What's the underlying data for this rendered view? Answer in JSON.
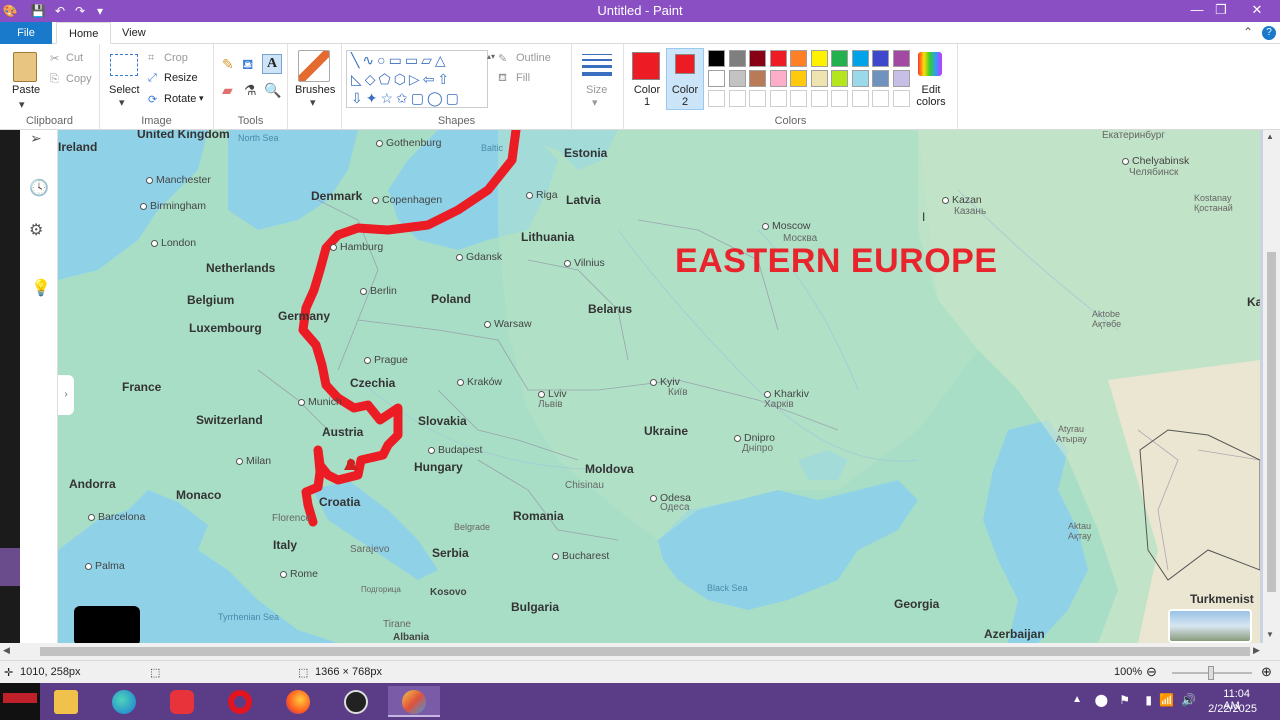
{
  "window": {
    "title": "Untitled - Paint",
    "minimize": "—",
    "maximize": "❐",
    "close": "✕"
  },
  "tabs": {
    "file": "File",
    "home": "Home",
    "view": "View"
  },
  "ribbon": {
    "clipboard": {
      "label": "Clipboard",
      "paste": "Paste",
      "cut": "Cut",
      "copy": "Copy"
    },
    "image": {
      "label": "Image",
      "select": "Select",
      "crop": "Crop",
      "resize": "Resize",
      "rotate": "Rotate"
    },
    "tools": {
      "label": "Tools"
    },
    "brushes": {
      "label": "Brushes"
    },
    "shapes": {
      "label": "Shapes",
      "outline": "Outline",
      "fill": "Fill"
    },
    "size": {
      "label": "Size"
    },
    "colors": {
      "label": "Colors",
      "color1": "Color 1",
      "color2": "Color 2",
      "edit": "Edit colors",
      "color1_value": "#ed1c24",
      "color2_value": "#ed1c24",
      "row1": [
        "#000000",
        "#7f7f7f",
        "#880015",
        "#ed1c24",
        "#ff7f27",
        "#fff200",
        "#22b14c",
        "#00a2e8",
        "#3f48cc",
        "#a349a4"
      ],
      "row2": [
        "#ffffff",
        "#c3c3c3",
        "#b97a57",
        "#ffaec9",
        "#ffc90e",
        "#efe4b0",
        "#b5e61d",
        "#99d9ea",
        "#7092be",
        "#c8bfe7"
      ]
    }
  },
  "map": {
    "headline": "EASTERN EUROPE",
    "countries": [
      "Ireland",
      "United Kingdom",
      "Denmark",
      "Estonia",
      "Latvia",
      "Lithuania",
      "Netherlands",
      "Belgium",
      "Luxembourg",
      "Germany",
      "Poland",
      "Belarus",
      "France",
      "Czechia",
      "Switzerland",
      "Austria",
      "Slovakia",
      "Hungary",
      "Ukraine",
      "Moldova",
      "Andorra",
      "Monaco",
      "Croatia",
      "Romania",
      "Italy",
      "Serbia",
      "Kosovo",
      "Bulgaria",
      "Albania",
      "Georgia",
      "Azerbaijan",
      "Turkmenist"
    ],
    "cities": [
      "Manchester",
      "Birmingham",
      "London",
      "Gothenburg",
      "Copenhagen",
      "Riga",
      "Hamburg",
      "Gdansk",
      "Vilnius",
      "Berlin",
      "Warsaw",
      "Prague",
      "Kraków",
      "Munich",
      "Milan",
      "Budapest",
      "Lviv",
      "Kyiv",
      "Kharkiv",
      "Dnipro",
      "Chisinau",
      "Odesa",
      "Barcelona",
      "Florence",
      "Belgrade",
      "Bucharest",
      "Sarajevo",
      "Rome",
      "Tirane",
      "Palma",
      "Moscow",
      "Kazan",
      "Chelyabinsk",
      "Atyrau",
      "Aktau",
      "Aktobe",
      "Kostanay"
    ],
    "cyrillic": {
      "moscow": "Москва",
      "kazan": "Казань",
      "chelyabinsk": "Челябинск",
      "kyiv": "Київ",
      "kharkiv": "Харків",
      "dnipro": "Дніпро",
      "lviv": "Львів",
      "odesa": "Одеса",
      "atyrau": "Атырау",
      "aktau": "Ақтау",
      "aktobe": "Ақтөбе",
      "kostanay": "Қостанай",
      "ekaterinburg": "Екатеринбург",
      "podgorica": "Подгорица"
    },
    "seas": {
      "north": "North Sea",
      "baltic": "Baltic",
      "black": "Black Sea",
      "tyrrhenian": "Tyrrhenian Sea"
    }
  },
  "status": {
    "cursor": "1010, 258px",
    "size": "1366 × 768px",
    "zoom": "100%"
  },
  "taskbar": {
    "time": "11:04 AM",
    "date": "2/22/2025"
  }
}
